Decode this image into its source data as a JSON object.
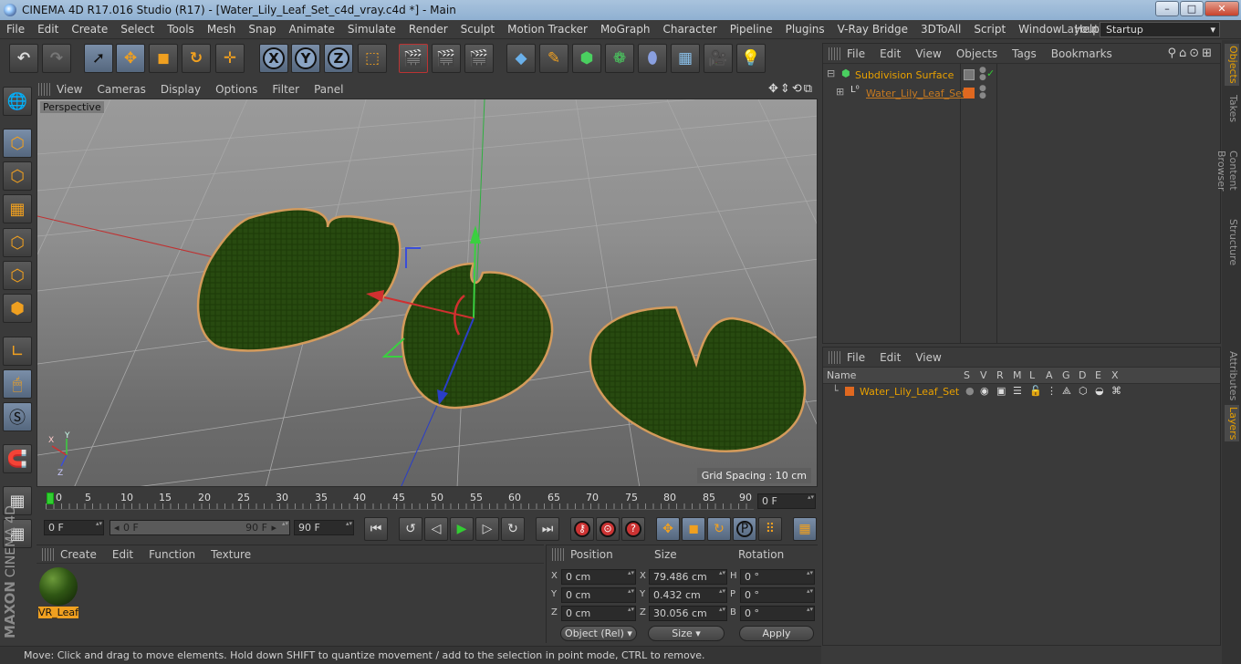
{
  "window": {
    "title": "CINEMA 4D R17.016 Studio (R17) - [Water_Lily_Leaf_Set_c4d_vray.c4d *] - Main",
    "minimize": "–",
    "maximize": "□",
    "close": "✕"
  },
  "menubar": {
    "items": [
      "File",
      "Edit",
      "Create",
      "Select",
      "Tools",
      "Mesh",
      "Snap",
      "Animate",
      "Simulate",
      "Render",
      "Sculpt",
      "Motion Tracker",
      "MoGraph",
      "Character",
      "Pipeline",
      "Plugins",
      "V-Ray Bridge",
      "3DToAll",
      "Script",
      "Window",
      "Help"
    ],
    "layout_label": "Layout:",
    "layout_value": "Startup"
  },
  "toolbar": {
    "undo": "↶",
    "redo": "↷",
    "axis_x": "X",
    "axis_y": "Y",
    "axis_z": "Z"
  },
  "viewport": {
    "menu": [
      "View",
      "Cameras",
      "Display",
      "Options",
      "Filter",
      "Panel"
    ],
    "label": "Perspective",
    "grid_spacing": "Grid Spacing : 10 cm",
    "axis_labels": {
      "x": "X",
      "y": "Y",
      "z": "Z"
    }
  },
  "timeline": {
    "ticks": [
      "0",
      "5",
      "10",
      "15",
      "20",
      "25",
      "30",
      "35",
      "40",
      "45",
      "50",
      "55",
      "60",
      "65",
      "70",
      "75",
      "80",
      "85",
      "90"
    ],
    "current_frame": "0 F"
  },
  "transport": {
    "start_field": "0 F",
    "range_start": "0 F",
    "range_end": "90 F",
    "end_field": "90 F",
    "key_p": "P"
  },
  "material_manager": {
    "menu": [
      "Create",
      "Edit",
      "Function",
      "Texture"
    ],
    "materials": [
      {
        "name": "VR_Leaf"
      }
    ]
  },
  "coordinates": {
    "headers": {
      "position": "Position",
      "size": "Size",
      "rotation": "Rotation"
    },
    "rows": [
      {
        "axis": "X",
        "pos": "0 cm",
        "size_axis": "X",
        "size": "79.486 cm",
        "rot_axis": "H",
        "rot": "0 °"
      },
      {
        "axis": "Y",
        "pos": "0 cm",
        "size_axis": "Y",
        "size": "0.432 cm",
        "rot_axis": "P",
        "rot": "0 °"
      },
      {
        "axis": "Z",
        "pos": "0 cm",
        "size_axis": "Z",
        "size": "30.056 cm",
        "rot_axis": "B",
        "rot": "0 °"
      }
    ],
    "mode": "Object (Rel)",
    "size_mode": "Size",
    "apply": "Apply"
  },
  "status": {
    "text": "Move: Click and drag to move elements. Hold down SHIFT to quantize movement / add to the selection in point mode, CTRL to remove."
  },
  "object_manager": {
    "menu": [
      "File",
      "Edit",
      "View",
      "Objects",
      "Tags",
      "Bookmarks"
    ],
    "objects": [
      {
        "name": "Subdivision Surface",
        "color": "#e8a000"
      },
      {
        "name": "Water_Lily_Leaf_Set",
        "color": "#c87a20"
      }
    ]
  },
  "layer_manager": {
    "menu": [
      "File",
      "Edit",
      "View"
    ],
    "columns": [
      "Name",
      "S",
      "V",
      "R",
      "M",
      "L",
      "A",
      "G",
      "D",
      "E",
      "X"
    ],
    "layers": [
      {
        "name": "Water_Lily_Leaf_Set",
        "color": "#e06820"
      }
    ]
  },
  "right_tabs": [
    "Objects",
    "Takes",
    "Content Browser",
    "Structure",
    "Attributes",
    "Layers"
  ],
  "branding": {
    "maxon": "MAXON",
    "product": "CINEMA 4D"
  }
}
